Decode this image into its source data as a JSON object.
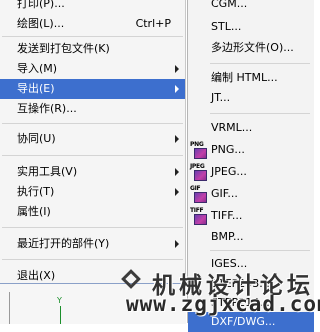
{
  "main_menu": {
    "items": [
      {
        "label": "打印(P)...",
        "shortcut": "",
        "submenu": false
      },
      {
        "label": "绘图(L)...",
        "shortcut": "Ctrl+P",
        "submenu": false
      },
      {
        "label": "发送到打包文件(K)",
        "shortcut": "",
        "submenu": false
      },
      {
        "label": "导入(M)",
        "shortcut": "",
        "submenu": true
      },
      {
        "label": "导出(E)",
        "shortcut": "",
        "submenu": true
      },
      {
        "label": "互操作(R)...",
        "shortcut": "",
        "submenu": false
      },
      {
        "label": "协同(U)",
        "shortcut": "",
        "submenu": true
      },
      {
        "label": "实用工具(V)",
        "shortcut": "",
        "submenu": true
      },
      {
        "label": "执行(T)",
        "shortcut": "",
        "submenu": true
      },
      {
        "label": "属性(I)",
        "shortcut": "",
        "submenu": false
      },
      {
        "label": "最近打开的部件(Y)",
        "shortcut": "",
        "submenu": true
      },
      {
        "label": "退出(X)",
        "shortcut": "",
        "submenu": false
      }
    ]
  },
  "export_submenu": {
    "items": [
      {
        "label": "CGM...",
        "icon": ""
      },
      {
        "label": "STL...",
        "icon": ""
      },
      {
        "label": "多边形文件(O)...",
        "icon": ""
      },
      {
        "label": "编制 HTML...",
        "icon": ""
      },
      {
        "label": "JT...",
        "icon": ""
      },
      {
        "label": "VRML...",
        "icon": ""
      },
      {
        "label": "PNG...",
        "icon": "PNG"
      },
      {
        "label": "JPEG...",
        "icon": "JPEG"
      },
      {
        "label": "GIF...",
        "icon": "GIF"
      },
      {
        "label": "TIFF...",
        "icon": "TIFF"
      },
      {
        "label": "BMP...",
        "icon": ""
      },
      {
        "label": "IGES...",
        "icon": ""
      },
      {
        "label": "STEP203...",
        "icon": ""
      },
      {
        "label": "STEP214...",
        "icon": ""
      },
      {
        "label": "DXF/DWG...",
        "icon": ""
      }
    ]
  },
  "graphics_window": {
    "axis_label": "Y"
  },
  "watermark": {
    "title": "机械设计论坛",
    "url": "www.zgjxcad.com"
  },
  "colors": {
    "highlight": "#3d6fce",
    "menu_background": "#f5f5f5"
  }
}
